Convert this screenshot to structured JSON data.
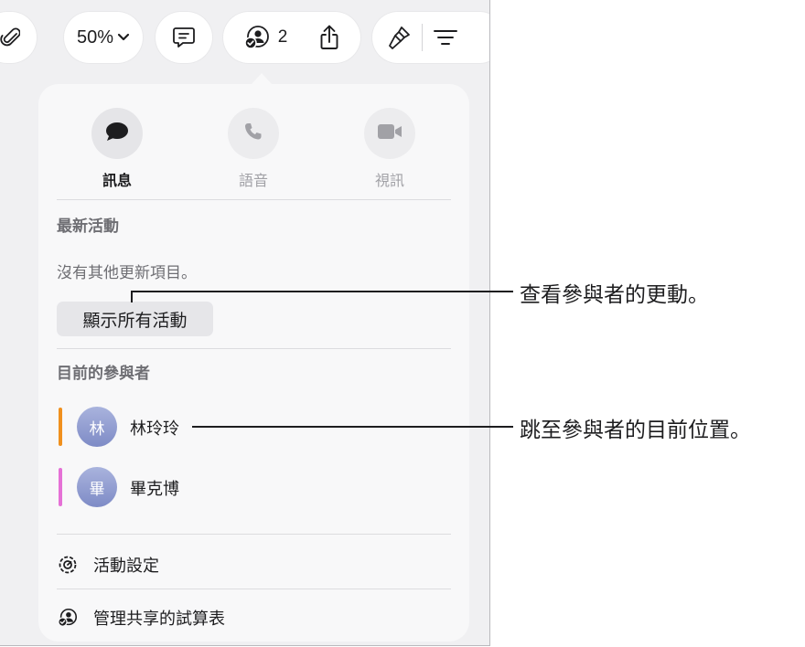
{
  "toolbar": {
    "zoom_label": "50%",
    "collaborator_count": "2"
  },
  "comm": {
    "message_label": "訊息",
    "voice_label": "語音",
    "video_label": "視訊"
  },
  "activity": {
    "section_title": "最新活動",
    "no_updates_text": "沒有其他更新項目。",
    "show_all_label": "顯示所有活動"
  },
  "participants": {
    "section_title": "目前的參與者",
    "items": [
      {
        "avatar_initial": "林",
        "name": "林玲玲",
        "color": "#f0901e"
      },
      {
        "avatar_initial": "畢",
        "name": "畢克博",
        "color": "#e571d6"
      }
    ]
  },
  "menu": {
    "activity_settings_label": "活動設定",
    "manage_sharing_label": "管理共享的試算表"
  },
  "callouts": {
    "view_changes": "查看參與者的更動。",
    "jump_to_location": "跳至參與者的目前位置。"
  }
}
